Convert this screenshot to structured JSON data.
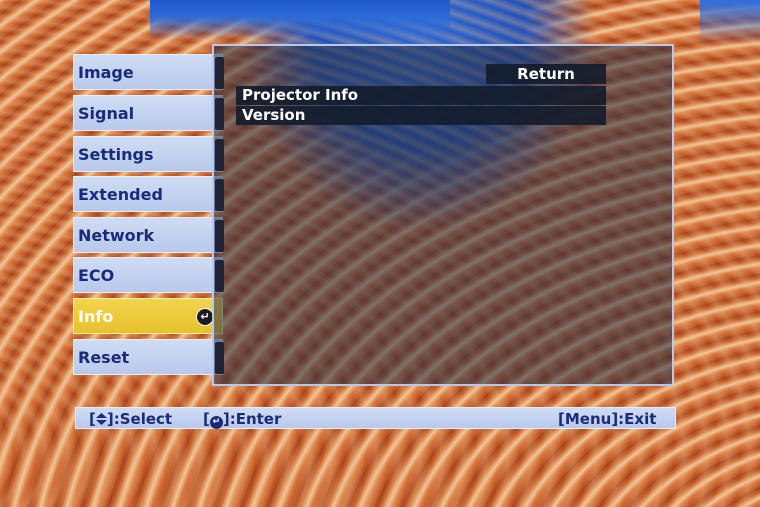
{
  "menu": {
    "items": [
      {
        "label": "Image"
      },
      {
        "label": "Signal"
      },
      {
        "label": "Settings"
      },
      {
        "label": "Extended"
      },
      {
        "label": "Network"
      },
      {
        "label": "ECO"
      },
      {
        "label": "Info",
        "selected": true
      },
      {
        "label": "Reset"
      }
    ]
  },
  "panel": {
    "return_label": "Return",
    "rows": [
      {
        "label": "Projector Info"
      },
      {
        "label": "Version"
      }
    ]
  },
  "bottom_bar": {
    "select_prefix": "[",
    "select_suffix": "]:Select",
    "enter_prefix": "[",
    "enter_suffix": "]:Enter",
    "exit_label": "[Menu]:Exit"
  },
  "icons": {
    "select": "up-down-diamond-icon",
    "enter": "enter-icon"
  },
  "colors": {
    "menu_bg": "#c4d3f0",
    "menu_text": "#1c2a7a",
    "selected_bg": "#ecc93a",
    "selected_text": "#ffffff",
    "panel_bg": "#232d46"
  }
}
